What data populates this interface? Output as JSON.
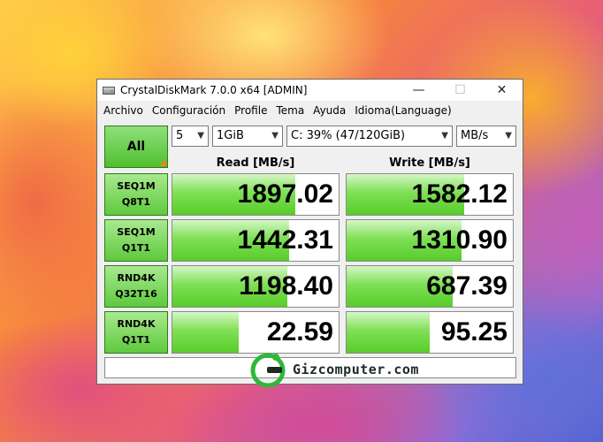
{
  "window": {
    "title": "CrystalDiskMark 7.0.0 x64 [ADMIN]",
    "controls": {
      "minimize": "—",
      "maximize": "☐",
      "close": "✕"
    }
  },
  "menu": [
    "Archivo",
    "Configuración",
    "Profile",
    "Tema",
    "Ayuda",
    "Idioma(Language)"
  ],
  "toolbar": {
    "all_label": "All",
    "count": "5",
    "size": "1GiB",
    "drive": "C: 39% (47/120GiB)",
    "unit": "MB/s"
  },
  "headers": {
    "read": "Read [MB/s]",
    "write": "Write [MB/s]"
  },
  "rows": [
    {
      "line1": "SEQ1M",
      "line2": "Q8T1",
      "read": "1897.02",
      "write": "1582.12",
      "read_fill": 0.74,
      "write_fill": 0.71
    },
    {
      "line1": "SEQ1M",
      "line2": "Q1T1",
      "read": "1442.31",
      "write": "1310.90",
      "read_fill": 0.7,
      "write_fill": 0.69
    },
    {
      "line1": "RND4K",
      "line2": "Q32T16",
      "read": "1198.40",
      "write": "687.39",
      "read_fill": 0.69,
      "write_fill": 0.64
    },
    {
      "line1": "RND4K",
      "line2": "Q1T1",
      "read": "22.59",
      "write": "95.25",
      "read_fill": 0.4,
      "write_fill": 0.5
    }
  ],
  "watermark": {
    "text": "Gizcomputer.com"
  },
  "colors": {
    "accent_green": "#58cc2a",
    "corner_orange": "#e3891e",
    "logo_green": "#2db83a"
  }
}
